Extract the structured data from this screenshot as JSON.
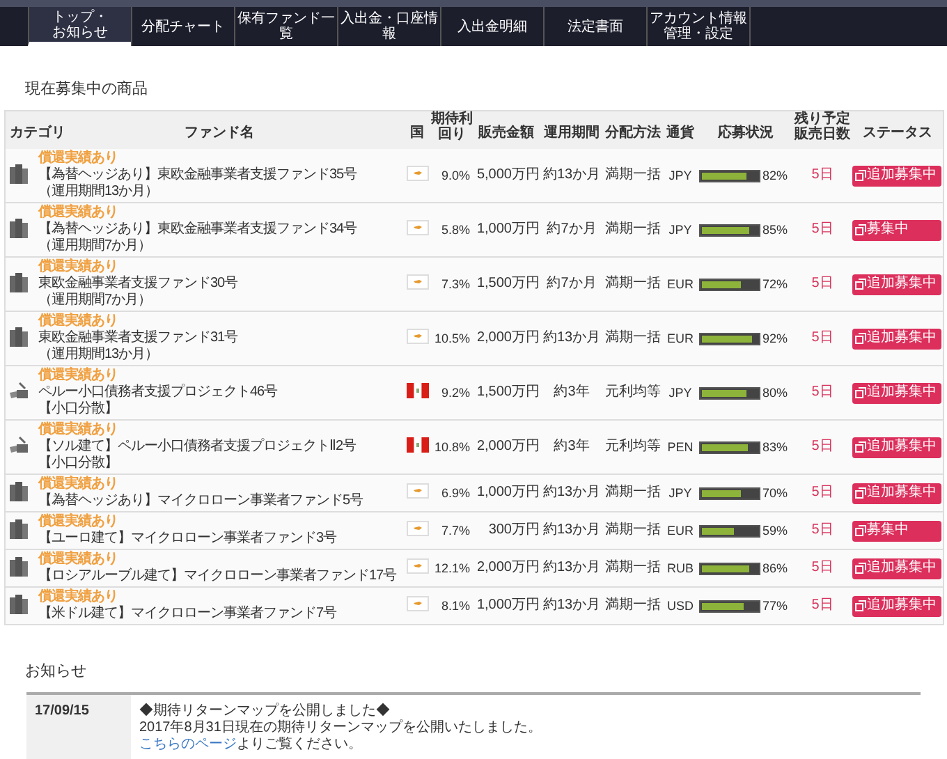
{
  "nav": [
    {
      "label": "トップ・お知らせ",
      "selected": true
    },
    {
      "label": "分配チャート",
      "selected": false
    },
    {
      "label": "保有ファンド一覧",
      "selected": false
    },
    {
      "label": "入出金・口座情報",
      "selected": false
    },
    {
      "label": "入出金明細",
      "selected": false
    },
    {
      "label": "法定書面",
      "selected": false
    },
    {
      "label": "アカウント情報管理・設定",
      "selected": false
    }
  ],
  "products": {
    "title": "現在募集中の商品",
    "columns": [
      "カテゴリ",
      "ファンド名",
      "国",
      "期待利回り",
      "販売金額",
      "運用期間",
      "分配方法",
      "通貨",
      "応募状況",
      "残り予定販売日数",
      "ステータス"
    ],
    "rows": [
      {
        "kind": "building",
        "badge": "償還実績あり",
        "name": "【為替ヘッジあり】東欧金融事業者支援ファンド35号",
        "note": "（運用期間13か月）",
        "country": {
          "kind": "cyprus"
        },
        "rate": "9.0%",
        "amount": "5,000万円",
        "period": "約13か月",
        "method": "満期一括",
        "currency": "JPY",
        "level": 0.82,
        "percent": "82%",
        "days": "5日",
        "status": "追加募集中"
      },
      {
        "kind": "building",
        "badge": "償還実績あり",
        "name": "【為替ヘッジあり】東欧金融事業者支援ファンド34号",
        "note": "（運用期間7か月）",
        "country": {
          "kind": "cyprus"
        },
        "rate": "5.8%",
        "amount": "1,000万円",
        "period": "約7か月",
        "method": "満期一括",
        "currency": "JPY",
        "level": 0.85,
        "percent": "85%",
        "days": "5日",
        "status": "募集中"
      },
      {
        "kind": "building",
        "badge": "償還実績あり",
        "name": "東欧金融事業者支援ファンド30号",
        "note": "（運用期間7か月）",
        "country": {
          "kind": "cyprus"
        },
        "rate": "7.3%",
        "amount": "1,500万円",
        "period": "約7か月",
        "method": "満期一括",
        "currency": "EUR",
        "level": 0.72,
        "percent": "72%",
        "days": "5日",
        "status": "追加募集中"
      },
      {
        "kind": "building",
        "badge": "償還実績あり",
        "name": "東欧金融事業者支援ファンド31号",
        "note": "（運用期間13か月）",
        "country": {
          "kind": "cyprus"
        },
        "rate": "10.5%",
        "amount": "2,000万円",
        "period": "約13か月",
        "method": "満期一括",
        "currency": "EUR",
        "level": 0.92,
        "percent": "92%",
        "days": "5日",
        "status": "追加募集中"
      },
      {
        "kind": "loan",
        "badge": "償還実績あり",
        "name": "ペルー小口債務者支援プロジェクト46号",
        "note": "【小口分散】",
        "country": {
          "kind": "peru"
        },
        "rate": "9.2%",
        "amount": "1,500万円",
        "period": "約3年",
        "method": "元利均等",
        "currency": "JPY",
        "level": 0.8,
        "percent": "80%",
        "days": "5日",
        "status": "追加募集中"
      },
      {
        "kind": "loan",
        "badge": "償還実績あり",
        "name": "【ソル建て】ペルー小口債務者支援プロジェクトⅡ2号",
        "note": "【小口分散】",
        "country": {
          "kind": "peru"
        },
        "rate": "10.8%",
        "amount": "2,000万円",
        "period": "約3年",
        "method": "元利均等",
        "currency": "PEN",
        "level": 0.83,
        "percent": "83%",
        "days": "5日",
        "status": "追加募集中"
      },
      {
        "kind": "building",
        "badge": "償還実績あり",
        "name": "【為替ヘッジあり】マイクロローン事業者ファンド5号",
        "country": {
          "kind": "cyprus"
        },
        "rate": "6.9%",
        "amount": "1,000万円",
        "period": "約13か月",
        "method": "満期一括",
        "currency": "JPY",
        "level": 0.7,
        "percent": "70%",
        "days": "5日",
        "status": "追加募集中"
      },
      {
        "kind": "building",
        "badge": "償還実績あり",
        "name": "【ユーロ建て】マイクロローン事業者ファンド3号",
        "country": {
          "kind": "cyprus"
        },
        "rate": "7.7%",
        "amount": "300万円",
        "period": "約13か月",
        "method": "満期一括",
        "currency": "EUR",
        "level": 0.59,
        "percent": "59%",
        "days": "5日",
        "status": "募集中"
      },
      {
        "kind": "building",
        "badge": "償還実績あり",
        "name": "【ロシアルーブル建て】マイクロローン事業者ファンド17号",
        "country": {
          "kind": "cyprus"
        },
        "rate": "12.1%",
        "amount": "2,000万円",
        "period": "約13か月",
        "method": "満期一括",
        "currency": "RUB",
        "level": 0.86,
        "percent": "86%",
        "days": "5日",
        "status": "追加募集中"
      },
      {
        "kind": "building",
        "badge": "償還実績あり",
        "name": "【米ドル建て】マイクロローン事業者ファンド7号",
        "country": {
          "kind": "cyprus"
        },
        "rate": "8.1%",
        "amount": "1,000万円",
        "period": "約13か月",
        "method": "満期一括",
        "currency": "USD",
        "level": 0.77,
        "percent": "77%",
        "days": "5日",
        "status": "追加募集中"
      }
    ]
  },
  "news": {
    "title": "お知らせ",
    "items": [
      {
        "date": "17/09/15",
        "headline": "◆期待リターンマップを公開しました◆",
        "body": "2017年8月31日現在の期待リターンマップを公開いたしました。",
        "link": "こちらのページ",
        "after_link": "よりご覧ください。"
      }
    ]
  }
}
